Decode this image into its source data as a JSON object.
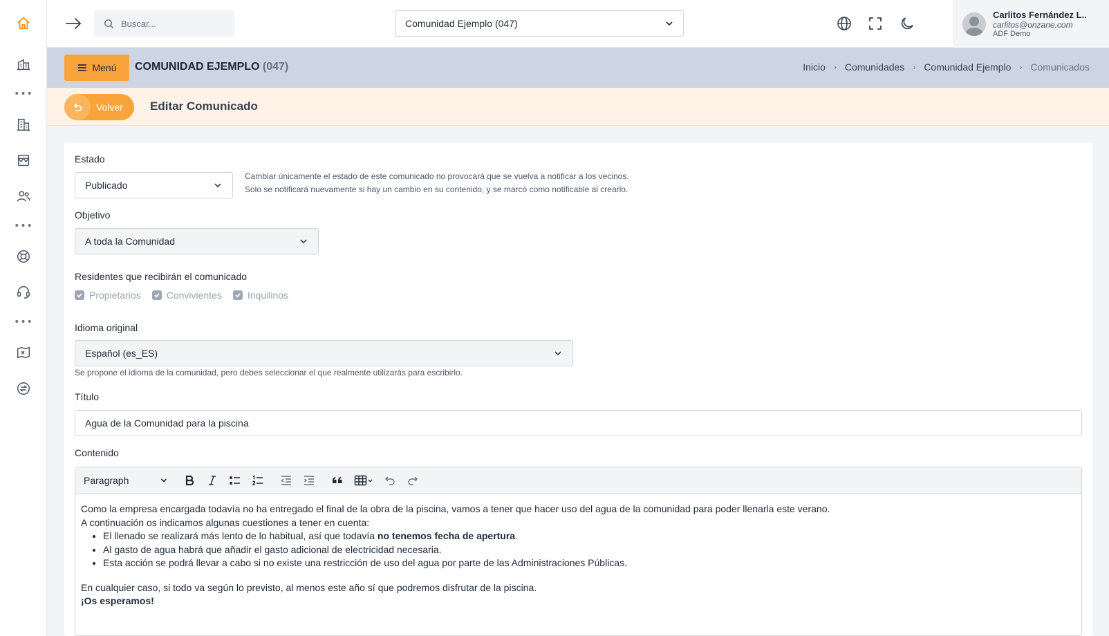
{
  "topbar": {
    "search_placeholder": "Buscar...",
    "community_select": "Comunidad Ejemplo (047)",
    "user": {
      "name": "Carlitos Fernández L..",
      "email": "carlitos@onzane.com",
      "org": "ADF Demo"
    }
  },
  "header": {
    "menu_label": "Menú",
    "community_name": "COMUNIDAD EJEMPLO",
    "community_code": "(047)",
    "breadcrumb": [
      "Inicio",
      "Comunidades",
      "Comunidad Ejemplo",
      "Comunicados"
    ]
  },
  "action": {
    "back_label": "Volver",
    "title": "Editar Comunicado"
  },
  "form": {
    "estado": {
      "label": "Estado",
      "value": "Publicado",
      "hint_line1": "Cambiar únicamente el estado de este comunicado no provocará que se vuelva a notificar a los vecinos.",
      "hint_line2": "Solo se notificará nuevamente si hay un cambio en su contenido, y se marcó como notificable al crearlo."
    },
    "objetivo": {
      "label": "Objetivo",
      "value": "A toda la Comunidad"
    },
    "residentes": {
      "label": "Residentes que recibirán el comunicado",
      "options": [
        "Propietarios",
        "Convivientes",
        "Inquilinos"
      ]
    },
    "idioma": {
      "label": "Idioma original",
      "value": "Español (es_ES)",
      "hint": "Se propone el idioma de la comunidad, pero debes seleccionar el que realmente utilizarás para escribirlo."
    },
    "titulo": {
      "label": "Título",
      "value": "Agua de la Comunidad para la piscina"
    },
    "contenido": {
      "label": "Contenido",
      "toolbar_format": "Paragraph",
      "p1": "Como la empresa encargada todavía no ha entregado el final de la obra de la piscina, vamos a tener que hacer uso del agua de la comunidad para poder llenarla este verano.",
      "p2": "A continuación os indicamos algunas cuestiones a tener en cuenta:",
      "li1_pre": "El llenado se realizará más lento de lo habitual, así que todavía ",
      "li1_bold": "no tenemos fecha de apertura",
      "li1_post": ".",
      "li2": "Al gasto de agua habrá que añadir el gasto adicional de electricidad necesaria.",
      "li3": "Esta acción se podrá llevar a cabo si no existe una restricción de uso del agua por parte de las Administraciones Públicas.",
      "p3": "En cualquier caso, si todo va según lo previsto, al menos este año sí que podremos disfrutar de la piscina.",
      "p4": "¡Os esperamos!"
    }
  },
  "colors": {
    "accent": "#f9a43a",
    "header_bg": "#cdd4e3",
    "action_bg": "#fef3e6"
  }
}
